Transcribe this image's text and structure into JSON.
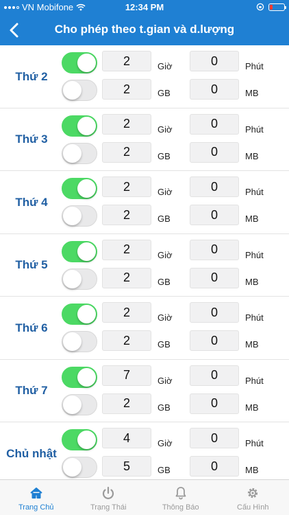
{
  "status_bar": {
    "carrier": "VN Mobifone",
    "time": "12:34 PM"
  },
  "header": {
    "title": "Cho phép theo t.gian và d.lượng"
  },
  "units": {
    "hour": "Giờ",
    "minute": "Phút",
    "gb": "GB",
    "mb": "MB"
  },
  "days": [
    {
      "label": "Thứ 2",
      "time_enabled": true,
      "data_enabled": false,
      "hours": "2",
      "minutes": "0",
      "gb": "2",
      "mb": "0"
    },
    {
      "label": "Thứ 3",
      "time_enabled": true,
      "data_enabled": false,
      "hours": "2",
      "minutes": "0",
      "gb": "2",
      "mb": "0"
    },
    {
      "label": "Thứ 4",
      "time_enabled": true,
      "data_enabled": false,
      "hours": "2",
      "minutes": "0",
      "gb": "2",
      "mb": "0"
    },
    {
      "label": "Thứ 5",
      "time_enabled": true,
      "data_enabled": false,
      "hours": "2",
      "minutes": "0",
      "gb": "2",
      "mb": "0"
    },
    {
      "label": "Thứ 6",
      "time_enabled": true,
      "data_enabled": false,
      "hours": "2",
      "minutes": "0",
      "gb": "2",
      "mb": "0"
    },
    {
      "label": "Thứ 7",
      "time_enabled": true,
      "data_enabled": false,
      "hours": "7",
      "minutes": "0",
      "gb": "2",
      "mb": "0"
    },
    {
      "label": "Chủ nhật",
      "time_enabled": true,
      "data_enabled": false,
      "hours": "4",
      "minutes": "0",
      "gb": "5",
      "mb": "0"
    }
  ],
  "tabs": [
    {
      "label": "Trang Chủ",
      "icon": "home-icon",
      "active": true
    },
    {
      "label": "Trạng Thái",
      "icon": "power-icon",
      "active": false
    },
    {
      "label": "Thông Báo",
      "icon": "bell-icon",
      "active": false
    },
    {
      "label": "Cấu Hình",
      "icon": "gear-icon",
      "active": false
    }
  ],
  "colors": {
    "primary": "#1f80d3",
    "toggle_on": "#4cd964",
    "day_label": "#205fa3"
  }
}
